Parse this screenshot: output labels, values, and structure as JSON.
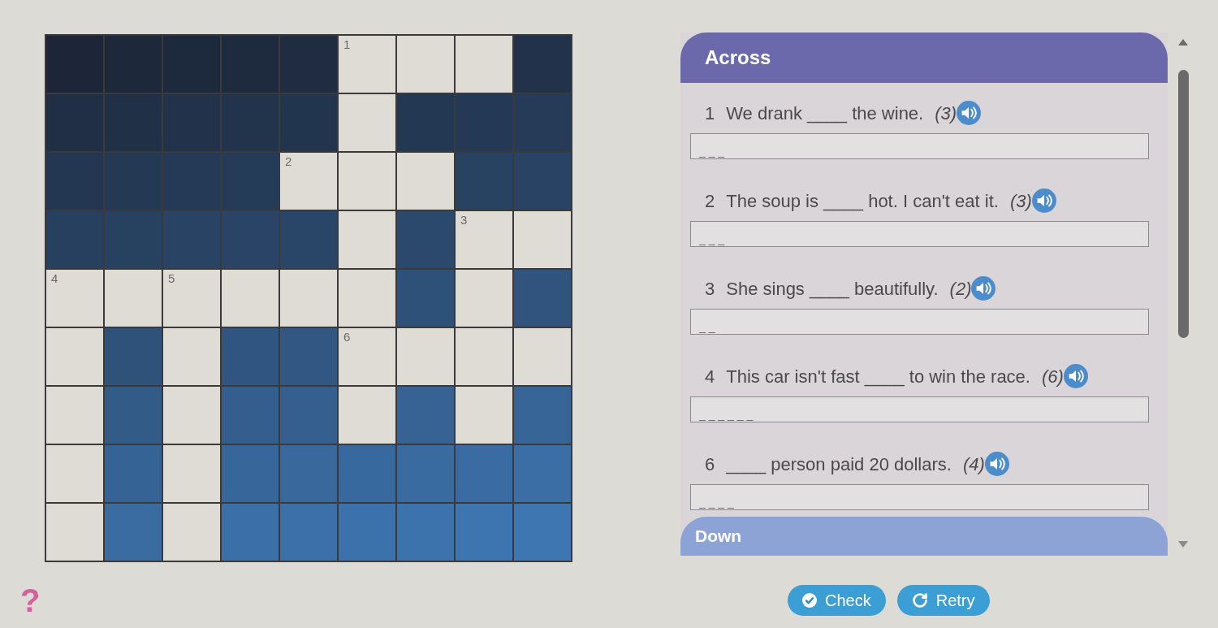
{
  "crossword": {
    "rows": [
      [
        {
          "kind": "block"
        },
        {
          "kind": "block"
        },
        {
          "kind": "block"
        },
        {
          "kind": "block"
        },
        {
          "kind": "block"
        },
        {
          "kind": "open",
          "number": "1"
        },
        {
          "kind": "open"
        },
        {
          "kind": "open"
        },
        {
          "kind": "block"
        }
      ],
      [
        {
          "kind": "block"
        },
        {
          "kind": "block"
        },
        {
          "kind": "block"
        },
        {
          "kind": "block"
        },
        {
          "kind": "block"
        },
        {
          "kind": "open"
        },
        {
          "kind": "block"
        },
        {
          "kind": "block"
        },
        {
          "kind": "block"
        }
      ],
      [
        {
          "kind": "block"
        },
        {
          "kind": "block"
        },
        {
          "kind": "block"
        },
        {
          "kind": "block"
        },
        {
          "kind": "open",
          "number": "2"
        },
        {
          "kind": "open"
        },
        {
          "kind": "open"
        },
        {
          "kind": "block"
        },
        {
          "kind": "block"
        }
      ],
      [
        {
          "kind": "block"
        },
        {
          "kind": "block"
        },
        {
          "kind": "block"
        },
        {
          "kind": "block"
        },
        {
          "kind": "block"
        },
        {
          "kind": "open"
        },
        {
          "kind": "block"
        },
        {
          "kind": "open",
          "number": "3"
        },
        {
          "kind": "open"
        }
      ],
      [
        {
          "kind": "open",
          "number": "4"
        },
        {
          "kind": "open"
        },
        {
          "kind": "open",
          "number": "5"
        },
        {
          "kind": "open"
        },
        {
          "kind": "open"
        },
        {
          "kind": "open"
        },
        {
          "kind": "block"
        },
        {
          "kind": "open"
        },
        {
          "kind": "block"
        }
      ],
      [
        {
          "kind": "open"
        },
        {
          "kind": "block"
        },
        {
          "kind": "open"
        },
        {
          "kind": "block"
        },
        {
          "kind": "block"
        },
        {
          "kind": "open",
          "number": "6"
        },
        {
          "kind": "open"
        },
        {
          "kind": "open"
        },
        {
          "kind": "open"
        }
      ],
      [
        {
          "kind": "open"
        },
        {
          "kind": "block"
        },
        {
          "kind": "open"
        },
        {
          "kind": "block"
        },
        {
          "kind": "block"
        },
        {
          "kind": "open"
        },
        {
          "kind": "block"
        },
        {
          "kind": "open"
        },
        {
          "kind": "block"
        }
      ],
      [
        {
          "kind": "open"
        },
        {
          "kind": "block"
        },
        {
          "kind": "open"
        },
        {
          "kind": "block"
        },
        {
          "kind": "block"
        },
        {
          "kind": "block"
        },
        {
          "kind": "block"
        },
        {
          "kind": "block"
        },
        {
          "kind": "block"
        }
      ],
      [
        {
          "kind": "open"
        },
        {
          "kind": "block"
        },
        {
          "kind": "open"
        },
        {
          "kind": "block"
        },
        {
          "kind": "block"
        },
        {
          "kind": "block"
        },
        {
          "kind": "block"
        },
        {
          "kind": "block"
        },
        {
          "kind": "block"
        }
      ]
    ]
  },
  "clue_panel": {
    "sections": [
      {
        "title": "Across",
        "expanded": true,
        "clues": [
          {
            "number": "1",
            "text": "We drank ____ the wine.",
            "length": "(3)",
            "answer_placeholder": "_ _ _"
          },
          {
            "number": "2",
            "text": "The soup is ____ hot. I can't eat it.",
            "length": "(3)",
            "answer_placeholder": "_ _ _"
          },
          {
            "number": "3",
            "text": "She sings ____ beautifully.",
            "length": "(2)",
            "answer_placeholder": "_ _"
          },
          {
            "number": "4",
            "text": "This car isn't fast ____ to win the race.",
            "length": "(6)",
            "answer_placeholder": "_ _ _ _ _ _"
          },
          {
            "number": "6",
            "text": "____ person paid 20 dollars.",
            "length": "(4)",
            "answer_placeholder": "_ _ _ _"
          }
        ]
      },
      {
        "title": "Down",
        "expanded": false
      }
    ]
  },
  "footer": {
    "help": "?",
    "buttons": [
      {
        "kind": "check",
        "label": "Check"
      },
      {
        "kind": "retry",
        "label": "Retry"
      }
    ]
  }
}
